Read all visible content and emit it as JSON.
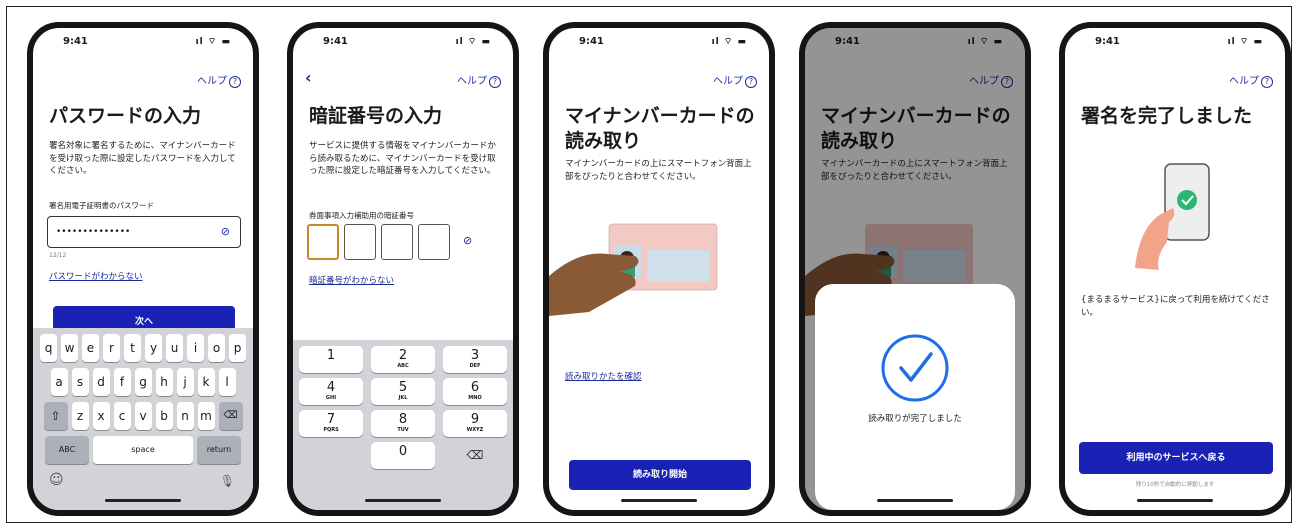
{
  "status": {
    "time": "9:41",
    "signal": "ıl ⌔ ▬"
  },
  "help": {
    "label": "ヘルプ",
    "icon": "?"
  },
  "screen1": {
    "title": "パスワードの入力",
    "desc": "署名対象に署名するために、マイナンバーカードを受け取った際に設定したパスワードを入力してください。",
    "field_label": "署名用電子証明書のパスワード",
    "field_value": "••••••••••••••",
    "count": "12/12",
    "forgot_link": "パスワードがわからない",
    "next_button": "次へ",
    "keyboard": {
      "row1": [
        "q",
        "w",
        "e",
        "r",
        "t",
        "y",
        "u",
        "i",
        "o",
        "p"
      ],
      "row2": [
        "a",
        "s",
        "d",
        "f",
        "g",
        "h",
        "j",
        "k",
        "l"
      ],
      "row3": [
        "z",
        "x",
        "c",
        "v",
        "b",
        "n",
        "m"
      ],
      "abc": "ABC",
      "space": "space",
      "return": "return"
    }
  },
  "screen2": {
    "title": "暗証番号の入力",
    "desc": "サービスに提供する情報をマイナンバーカードから読み取るために、マイナンバーカードを受け取った際に設定した暗証番号を入力してください。",
    "field_label": "券面事項入力補助用の暗証番号",
    "forgot_link": "暗証番号がわからない",
    "keys": [
      {
        "d": "1",
        "s": ""
      },
      {
        "d": "2",
        "s": "ABC"
      },
      {
        "d": "3",
        "s": "DEF"
      },
      {
        "d": "4",
        "s": "GHI"
      },
      {
        "d": "5",
        "s": "JKL"
      },
      {
        "d": "6",
        "s": "MNO"
      },
      {
        "d": "7",
        "s": "PQRS"
      },
      {
        "d": "8",
        "s": "TUV"
      },
      {
        "d": "9",
        "s": "WXYZ"
      },
      {
        "d": "0",
        "s": ""
      }
    ]
  },
  "screen3": {
    "title_line1": "マイナンバーカードの",
    "title_line2": "読み取り",
    "desc": "マイナンバーカードの上にスマートフォン背面上部をぴったりと合わせてください。",
    "howto_link": "読み取りかたを確認",
    "start_button": "読み取り開始"
  },
  "screen4": {
    "title_line1": "マイナンバーカードの",
    "title_line2": "読み取り",
    "desc": "マイナンバーカードの上にスマートフォン背面上部をぴったりと合わせてください。",
    "complete_text": "読み取りが完了しました"
  },
  "screen5": {
    "title": "署名を完了しました",
    "desc": "{まるまるサービス}に戻って利用を続けてください。",
    "return_button": "利用中のサービスへ戻る",
    "auto_note": "残り10秒で自動的に移動します"
  },
  "colors": {
    "accent": "#1a22b5",
    "pin_active": "#c98a2c",
    "card": "#f3c9c4",
    "check": "#1e6ee8"
  }
}
